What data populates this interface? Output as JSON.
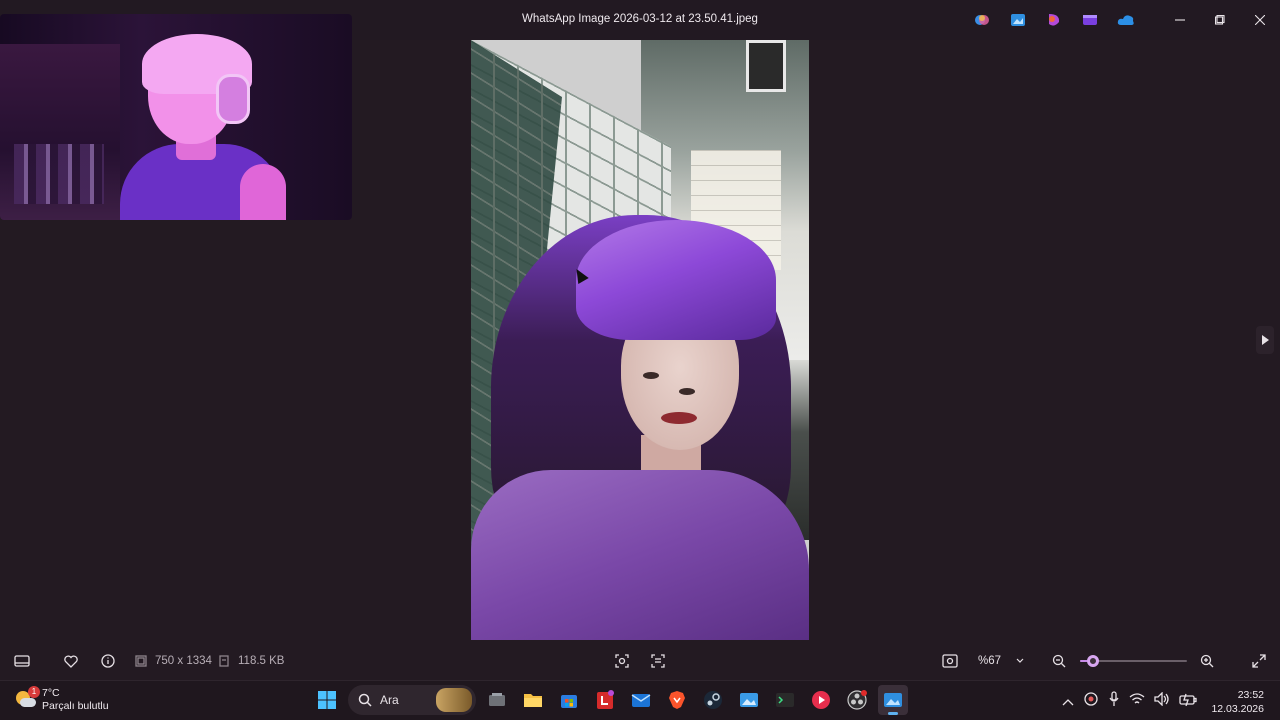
{
  "window": {
    "title": "WhatsApp Image 2026-03-12 at 23.50.41.jpeg",
    "header_apps": [
      "copilot-icon",
      "photos-icon",
      "designer-icon",
      "clipchamp-icon",
      "onedrive-icon"
    ]
  },
  "image_info": {
    "dimensions": "750 x 1334",
    "file_size": "118.5 KB"
  },
  "zoom": {
    "level_label": "%67",
    "level_fraction": 0.12
  },
  "weather": {
    "temperature": "7°C",
    "condition": "Parçalı bulutlu",
    "badge": "1"
  },
  "taskbar": {
    "search_placeholder": "Ara",
    "apps": [
      "start-icon",
      "search",
      "task-view-icon",
      "file-explorer-icon",
      "microsoft-store-icon",
      "libreoffice-icon",
      "outlook-icon",
      "brave-icon",
      "steam-icon",
      "photos-icon",
      "terminal-icon",
      "youtube-icon",
      "obs-icon",
      "photos-viewer-icon"
    ]
  },
  "clock": {
    "time": "23:52",
    "date": "12.03.2026"
  },
  "colors": {
    "background": "#231a22",
    "accent": "#c78ae8",
    "taskbar": "#1f171e"
  }
}
